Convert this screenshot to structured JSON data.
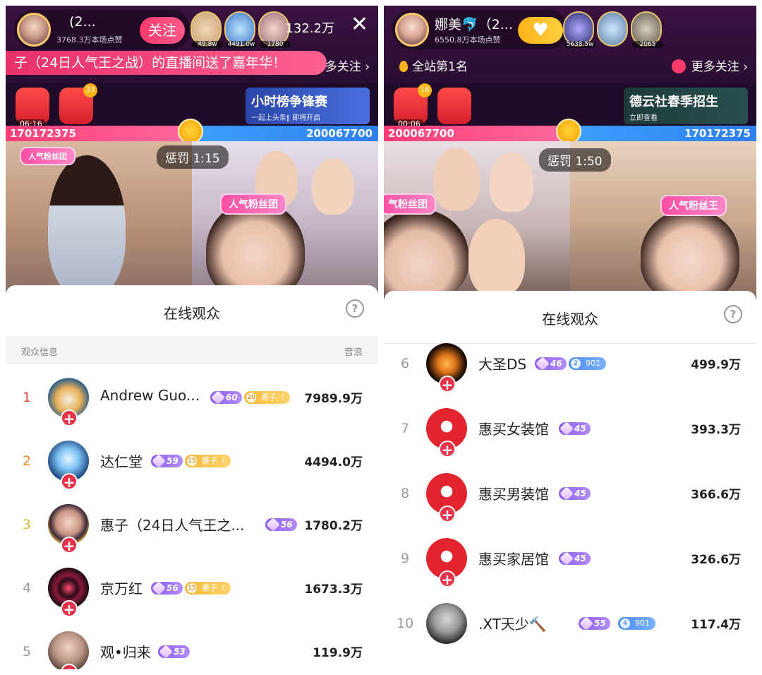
{
  "left": {
    "host": {
      "name": "   (2...",
      "likes": "3768.3万本场点赞",
      "follow": "关注"
    },
    "top_ranks": [
      "49.8w",
      "4491.0w",
      "1780"
    ],
    "viewers": "132.2万",
    "ticker": "子（24日人气王之战）的直播间送了嘉年华！",
    "more_follow": "多关注",
    "packets": [
      {
        "timer": "06:16"
      },
      {
        "badge": "33"
      }
    ],
    "promo": {
      "title": "小时榜争锋赛",
      "sub": "一起上头条‖ 即将开启"
    },
    "pk": {
      "left": "170172375",
      "right": "200067700",
      "penalty": "惩罚 1:15"
    },
    "fan_tags": [
      "人气粉丝团"
    ],
    "sheet": {
      "title": "在线观众",
      "col_left": "观众信息",
      "col_right": "音浪",
      "rows": [
        {
          "rank": "1",
          "name": "Andrew Guo...",
          "level": "60",
          "fan_num": "20",
          "fan_name": "惠子（",
          "amount": "7989.9万"
        },
        {
          "rank": "2",
          "name": "达仁堂",
          "level": "59",
          "fan_num": "15",
          "fan_name": "惠子（",
          "amount": "4494.0万"
        },
        {
          "rank": "3",
          "name": "惠子（24日人气王之...",
          "level": "56",
          "amount": "1780.2万"
        },
        {
          "rank": "4",
          "name": "京万红",
          "level": "56",
          "fan_num": "15",
          "fan_name": "惠子（",
          "amount": "1673.3万"
        },
        {
          "rank": "5",
          "name": "观•归来",
          "level": "53",
          "amount": "119.9万"
        }
      ]
    }
  },
  "right": {
    "host": {
      "name": "娜美🐬（2...",
      "likes": "6550.8万本场点赞",
      "follow": "♥"
    },
    "top_ranks": [
      "5638.5w",
      "",
      "2065"
    ],
    "station_rank": "全站第1名",
    "more_follow": "更多关注",
    "packets": [
      {
        "timer": "00:06",
        "badge": "16"
      },
      {}
    ],
    "promo": {
      "title": "德云社春季招生",
      "sub": "立即查看"
    },
    "pk": {
      "left": "200067700",
      "right": "170172375",
      "penalty": "惩罚 1:50"
    },
    "fan_tags": [
      "气粉丝团",
      "人气粉丝王"
    ],
    "sheet": {
      "title": "在线观众",
      "rows": [
        {
          "rank": "6",
          "name": "大圣DS",
          "level": "46",
          "fan_num": "2",
          "fan_name": "901",
          "amount": "499.9万"
        },
        {
          "rank": "7",
          "name": "惠买女装馆",
          "level": "45",
          "amount": "393.3万"
        },
        {
          "rank": "8",
          "name": "惠买男装馆",
          "level": "45",
          "amount": "366.6万"
        },
        {
          "rank": "9",
          "name": "惠买家居馆",
          "level": "45",
          "amount": "326.6万"
        },
        {
          "rank": "10",
          "name": ".XT天少🔨",
          "level": "55",
          "fan_num": "4",
          "fan_name": "901",
          "amount": "117.4万"
        }
      ]
    }
  },
  "colors": {
    "accent_red": "#e8324a",
    "pk_pink": "#ff3d77",
    "pk_blue": "#3da0ff",
    "level_purple": "#8a5cf0"
  }
}
